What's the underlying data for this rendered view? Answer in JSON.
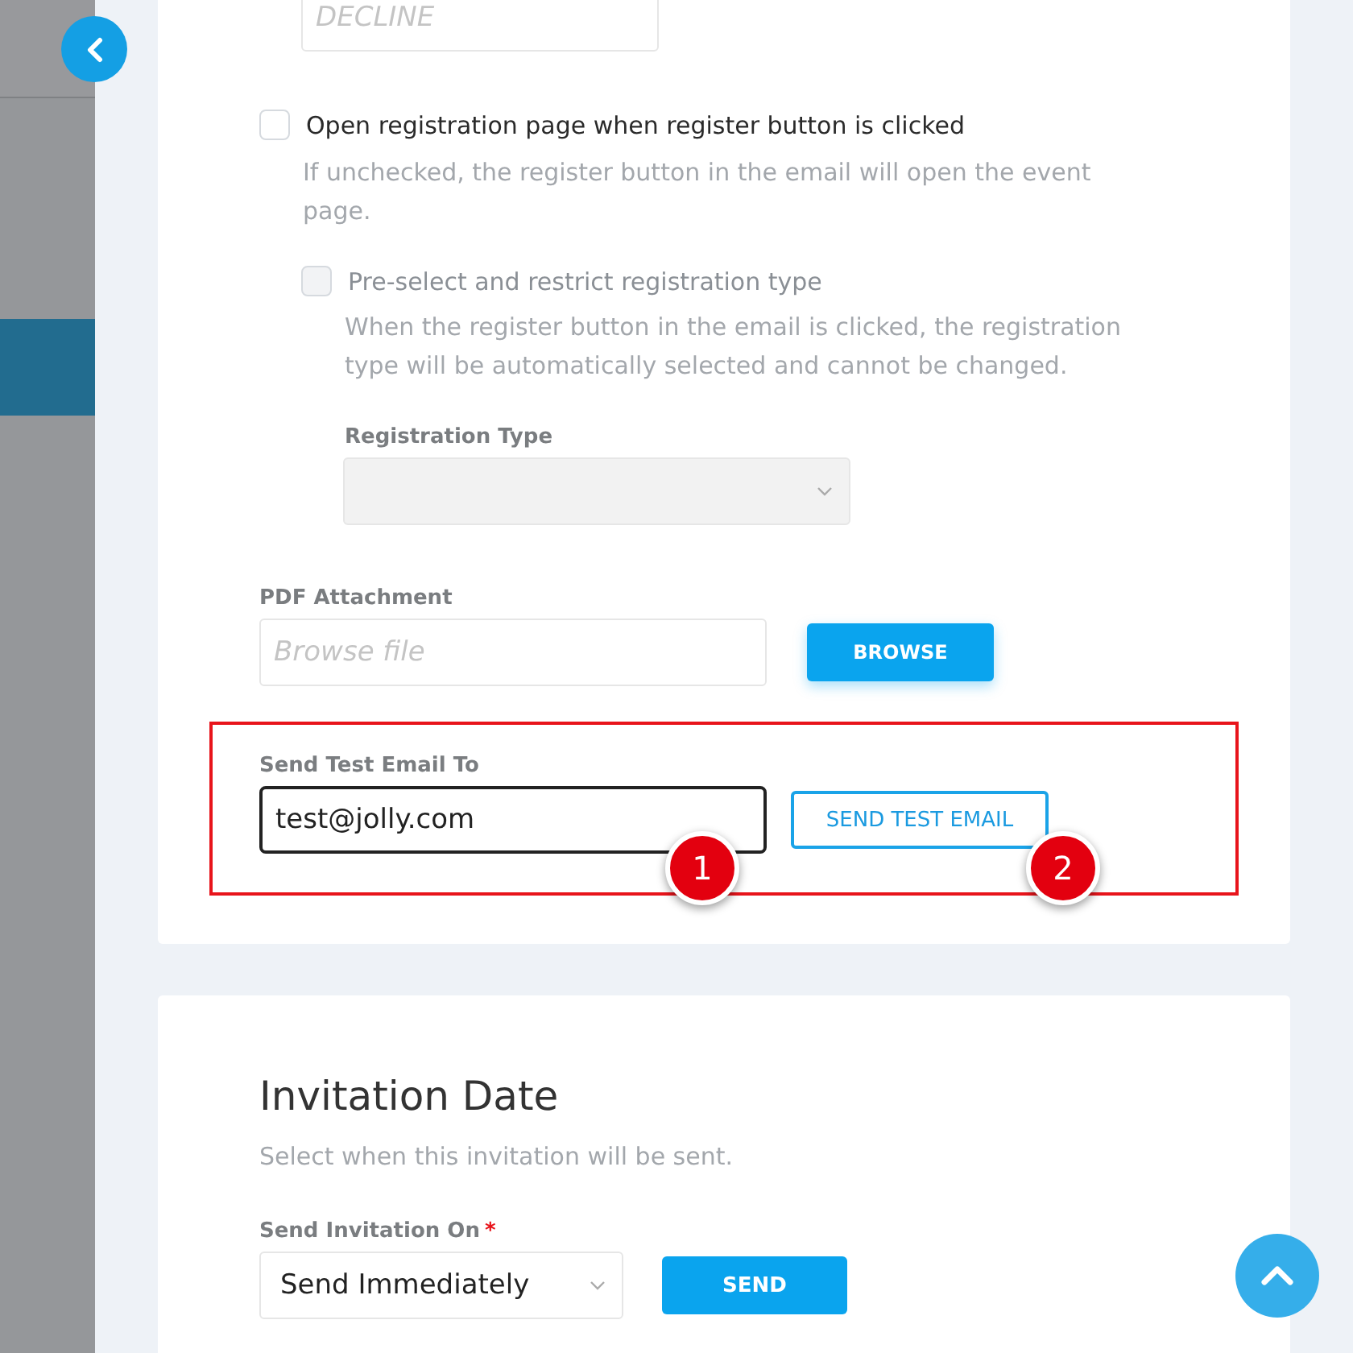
{
  "decline_field": {
    "placeholder": "DECLINE"
  },
  "open_registration": {
    "label": "Open registration page when register button is clicked",
    "checked": false,
    "help": "If unchecked, the register button in the email will open the event page."
  },
  "preselect": {
    "label": "Pre-select and restrict registration type",
    "checked": false,
    "disabled": true,
    "help": "When the register button in the email is clicked, the registration type will be automatically selected and cannot be changed."
  },
  "registration_type": {
    "label": "Registration Type",
    "disabled": true
  },
  "pdf_attachment": {
    "label": "PDF Attachment",
    "placeholder": "Browse file",
    "button": "BROWSE"
  },
  "test_email": {
    "label": "Send Test Email To",
    "value": "test@jolly.com",
    "button": "SEND TEST EMAIL",
    "markers": [
      "1",
      "2"
    ]
  },
  "invitation_date": {
    "title": "Invitation Date",
    "subtitle": "Select when this invitation will be sent.",
    "label": "Send Invitation On",
    "required": "*",
    "value": "Send Immediately",
    "button": "SEND"
  }
}
